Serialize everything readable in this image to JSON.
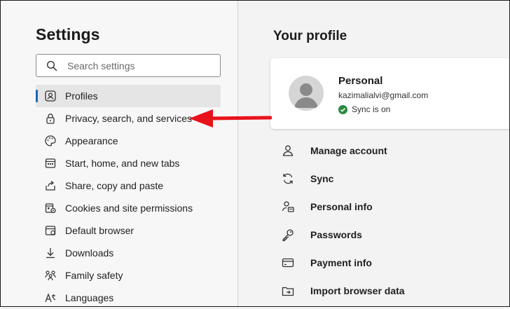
{
  "sidebar": {
    "title": "Settings",
    "search_placeholder": "Search settings",
    "items": [
      {
        "label": "Profiles",
        "icon": "profile-icon"
      },
      {
        "label": "Privacy, search, and services",
        "icon": "lock-icon"
      },
      {
        "label": "Appearance",
        "icon": "palette-icon"
      },
      {
        "label": "Start, home, and new tabs",
        "icon": "home-icon"
      },
      {
        "label": "Share, copy and paste",
        "icon": "share-icon"
      },
      {
        "label": "Cookies and site permissions",
        "icon": "cookies-icon"
      },
      {
        "label": "Default browser",
        "icon": "browser-icon"
      },
      {
        "label": "Downloads",
        "icon": "download-icon"
      },
      {
        "label": "Family safety",
        "icon": "family-icon"
      },
      {
        "label": "Languages",
        "icon": "languages-icon"
      }
    ]
  },
  "main": {
    "title": "Your profile",
    "profile": {
      "name": "Personal",
      "email": "kazimalialvi@gmail.com",
      "sync_status": "Sync is on"
    },
    "menu": [
      {
        "label": "Manage account",
        "icon": "person-icon"
      },
      {
        "label": "Sync",
        "icon": "sync-icon"
      },
      {
        "label": "Personal info",
        "icon": "person-card-icon"
      },
      {
        "label": "Passwords",
        "icon": "key-icon"
      },
      {
        "label": "Payment info",
        "icon": "credit-card-icon"
      },
      {
        "label": "Import browser data",
        "icon": "import-folder-icon"
      }
    ]
  },
  "colors": {
    "accent": "#1a67b8",
    "annotation_arrow": "#e8121b",
    "sync_ok": "#2a8a3e"
  }
}
